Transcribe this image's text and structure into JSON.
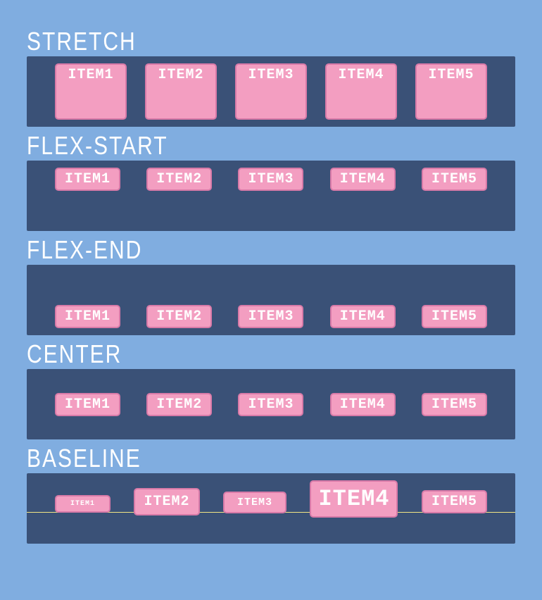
{
  "sections": [
    {
      "title": "stretch",
      "alignItems": "stretch",
      "items": [
        "ITEM1",
        "ITEM2",
        "ITEM3",
        "ITEM4",
        "ITEM5"
      ]
    },
    {
      "title": "flex-start",
      "alignItems": "flex-start",
      "items": [
        "ITEM1",
        "ITEM2",
        "ITEM3",
        "ITEM4",
        "ITEM5"
      ]
    },
    {
      "title": "flex-end",
      "alignItems": "flex-end",
      "items": [
        "ITEM1",
        "ITEM2",
        "ITEM3",
        "ITEM4",
        "ITEM5"
      ]
    },
    {
      "title": "center",
      "alignItems": "center",
      "items": [
        "ITEM1",
        "ITEM2",
        "ITEM3",
        "ITEM4",
        "ITEM5"
      ]
    },
    {
      "title": "baseline",
      "alignItems": "baseline",
      "items": [
        "ITEM1",
        "ITEM2",
        "ITEM3",
        "ITEM4",
        "ITEM5"
      ]
    }
  ]
}
